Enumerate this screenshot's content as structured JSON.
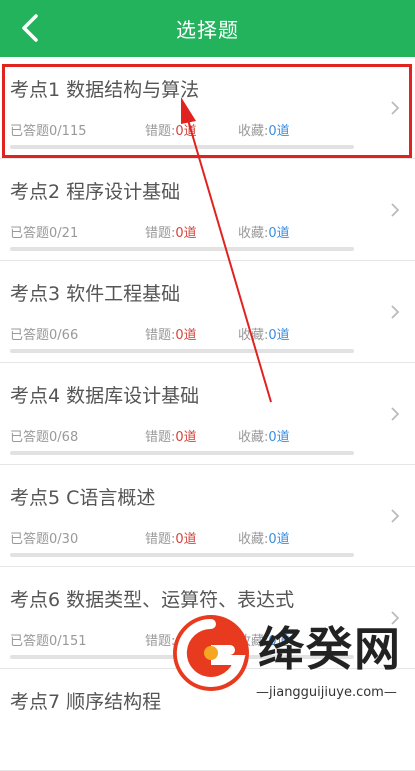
{
  "header": {
    "title": "选择题"
  },
  "items": [
    {
      "title": "考点1 数据结构与算法",
      "answered_label": "已答题",
      "answered": "0/115",
      "wrong_label": "错题:",
      "wrong": "0道",
      "fav_label": "收藏:",
      "fav": "0道",
      "progress": 0
    },
    {
      "title": "考点2 程序设计基础",
      "answered_label": "已答题",
      "answered": "0/21",
      "wrong_label": "错题:",
      "wrong": "0道",
      "fav_label": "收藏:",
      "fav": "0道",
      "progress": 0
    },
    {
      "title": "考点3 软件工程基础",
      "answered_label": "已答题",
      "answered": "0/66",
      "wrong_label": "错题:",
      "wrong": "0道",
      "fav_label": "收藏:",
      "fav": "0道",
      "progress": 0
    },
    {
      "title": "考点4 数据库设计基础",
      "answered_label": "已答题",
      "answered": "0/68",
      "wrong_label": "错题:",
      "wrong": "0道",
      "fav_label": "收藏:",
      "fav": "0道",
      "progress": 0
    },
    {
      "title": "考点5 C语言概述",
      "answered_label": "已答题",
      "answered": "0/30",
      "wrong_label": "错题:",
      "wrong": "0道",
      "fav_label": "收藏:",
      "fav": "0道",
      "progress": 0
    },
    {
      "title": "考点6 数据类型、运算符、表达式",
      "answered_label": "已答题",
      "answered": "0/151",
      "wrong_label": "错题:",
      "wrong": "0道",
      "fav_label": "收藏:",
      "fav": "0道",
      "progress": 0
    },
    {
      "title": "考点7 顺序结构程",
      "answered_label": "",
      "answered": "",
      "wrong_label": "",
      "wrong": "",
      "fav_label": "",
      "fav": "",
      "progress": 0
    }
  ],
  "watermark": {
    "brand": "绛癸网",
    "site": "—jiangguijiuye.com—"
  },
  "colors": {
    "header": "#23b35d",
    "wrong": "#d4453c",
    "fav": "#3b8de0",
    "highlight": "#e0231f"
  },
  "icons": {
    "back": "chevron-left-icon",
    "row": "chevron-right-icon"
  }
}
